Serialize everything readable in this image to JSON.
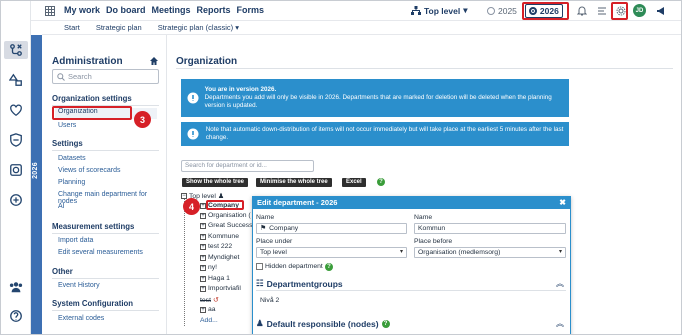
{
  "topbar": {
    "nav": [
      "My work",
      "Do board",
      "Meetings",
      "Reports",
      "Forms"
    ],
    "level_label": "Top level",
    "years": [
      "2025",
      "2026"
    ],
    "selected_year": "2026",
    "avatar_initials": "JD"
  },
  "subnav": [
    "Start",
    "Strategic plan",
    "Strategic plan (classic)"
  ],
  "year_strip": "2026",
  "sidebar": {
    "title": "Administration",
    "search_placeholder": "Search",
    "sections": [
      {
        "heading": "Organization settings",
        "items": [
          "Organization",
          "Users"
        ]
      },
      {
        "heading": "Settings",
        "items": [
          "Datasets",
          "Views of scorecards",
          "Planning",
          "Change main department for nodes",
          "AI"
        ]
      },
      {
        "heading": "Measurement settings",
        "items": [
          "Import data",
          "Edit several measurements"
        ]
      },
      {
        "heading": "Other",
        "items": [
          "Event History"
        ]
      },
      {
        "heading": "System Configuration",
        "items": [
          "External codes"
        ]
      }
    ]
  },
  "page": {
    "title": "Organization",
    "alert1_bold": "You are in version 2026.",
    "alert1_text": "Departments you add will only be visible in 2026. Departments that are marked for deletion will be deleted when the planning version is updated.",
    "alert2_text": "Note that automatic down-distribution of items will not occur immediately but will take place at the earliest 5 minutes after the last change.",
    "dept_search_placeholder": "Search for department or id...",
    "buttons": [
      "Show the whole tree",
      "Minimise the whole tree",
      "Excel"
    ]
  },
  "tree": {
    "root": "Top level",
    "nodes": [
      "Company",
      "Organisation (",
      "Great Success",
      "Kommune",
      "test 222",
      "Myndighet",
      "ny!",
      "Haga 1",
      "Importviafil",
      "test",
      "aa"
    ],
    "add_label": "Add..."
  },
  "dialog": {
    "title": "Edit department - 2026",
    "name_label": "Name",
    "name_value": "Company",
    "name2_label": "Name",
    "name2_value": "Kommun",
    "place_under_label": "Place under",
    "place_under_value": "Top level",
    "place_before_label": "Place before",
    "place_before_value": "Organisation (medlemsorg)",
    "hidden_label": "Hidden department",
    "section1": "Departmentgroups",
    "level_text": "Nivå 2",
    "section2": "Default responsible (nodes)"
  },
  "annotations": [
    "1",
    "2",
    "3",
    "4"
  ],
  "colors": {
    "accent": "#2b8fcc",
    "highlight_red": "#d62027",
    "navy": "#1f3d66",
    "year_strip": "#3d70b3"
  }
}
